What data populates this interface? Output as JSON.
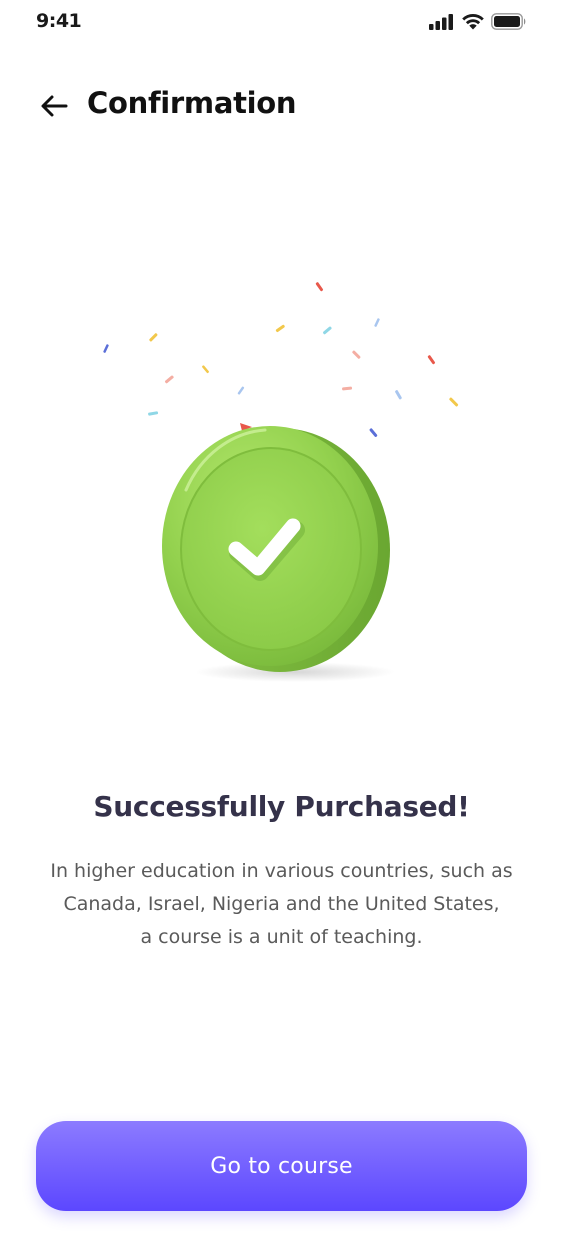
{
  "status_bar": {
    "time": "9:41",
    "icons": [
      "cellular-signal-icon",
      "wifi-icon",
      "battery-icon"
    ]
  },
  "header": {
    "title": "Confirmation",
    "back_icon": "arrow-left-icon"
  },
  "illustration": {
    "icon": "check-coin-icon",
    "color": "#8fd14f",
    "confetti_icon": "confetti-icon"
  },
  "message": {
    "title": "Successfully Purchased!",
    "description_lines": [
      "In higher education in various countries, such as",
      "Canada, Israel, Nigeria and the United States,",
      "a course is a unit of teaching."
    ]
  },
  "actions": {
    "primary_label": "Go to course",
    "primary_color": "#5c47ff"
  }
}
